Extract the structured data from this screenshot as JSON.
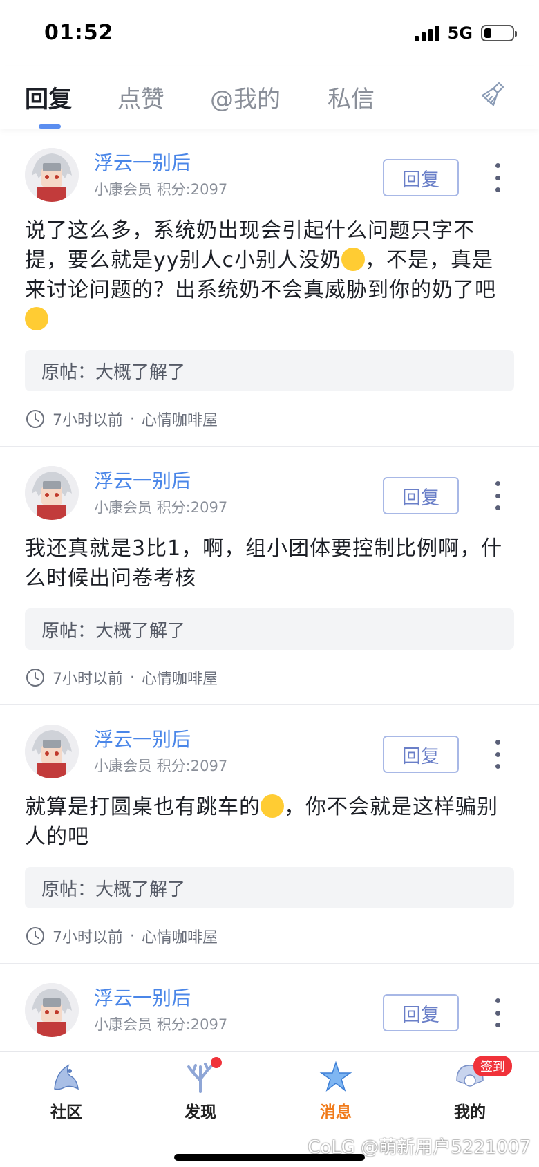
{
  "status": {
    "time": "01:52",
    "network": "5G",
    "signal_bars": 4,
    "battery_level": 0.25
  },
  "tabs": [
    {
      "label": "回复",
      "active": true
    },
    {
      "label": "点赞",
      "active": false
    },
    {
      "label": "@我的",
      "active": false
    },
    {
      "label": "私信",
      "active": false
    }
  ],
  "header_icon": "broom-icon",
  "items": [
    {
      "username": "浮云一别后",
      "meta": "小康会员 积分:2097",
      "reply_label": "回复",
      "content_before": "说了这么多，系统奶出现会引起什么问题只字不提，要么就是yy别人c小别人没奶",
      "content_mid": "，不是，真是来讨论问题的？出系统奶不会真威胁到你的奶了吧",
      "quote": "原帖：大概了解了",
      "time": "7小时以前",
      "board": "心情咖啡屋"
    },
    {
      "username": "浮云一别后",
      "meta": "小康会员 积分:2097",
      "reply_label": "回复",
      "content": "我还真就是3比1，啊，组小团体要控制比例啊，什么时候出问卷考核",
      "quote": "原帖：大概了解了",
      "time": "7小时以前",
      "board": "心情咖啡屋"
    },
    {
      "username": "浮云一别后",
      "meta": "小康会员 积分:2097",
      "reply_label": "回复",
      "content_before": "就算是打圆桌也有跳车的",
      "content_after": "，你不会就是这样骗别人的吧",
      "quote": "原帖：大概了解了",
      "time": "7小时以前",
      "board": "心情咖啡屋"
    },
    {
      "username": "浮云一别后",
      "meta": "小康会员 积分:2097",
      "reply_label": "回复"
    }
  ],
  "bottom_nav": [
    {
      "label": "社区",
      "icon": "community-icon",
      "active": false
    },
    {
      "label": "发现",
      "icon": "discover-icon",
      "active": false,
      "badge_dot": true
    },
    {
      "label": "消息",
      "icon": "message-icon",
      "active": true
    },
    {
      "label": "我的",
      "icon": "profile-icon",
      "active": false,
      "badge_text": "签到"
    }
  ],
  "watermark": "CoLG @萌新用户5221007",
  "colors": {
    "accent_blue": "#4a86e8",
    "active_orange": "#f07a1a",
    "badge_red": "#f0323a"
  }
}
